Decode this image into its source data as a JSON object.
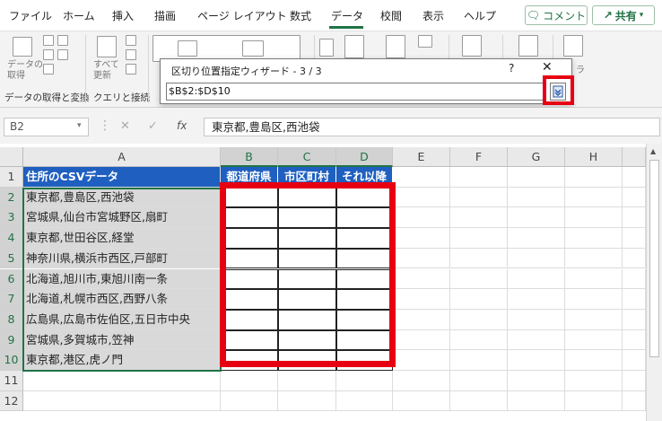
{
  "ribbon_tabs": [
    "ファイル",
    "ホーム",
    "挿入",
    "描画",
    "ページ レイアウト",
    "数式",
    "データ",
    "校閲",
    "表示",
    "ヘルプ"
  ],
  "active_tab": "データ",
  "comment_label": "コメント",
  "share_label": "共有",
  "ribbon": {
    "get_data_label": "データの\n取得",
    "refresh_all_label": "すべて\n更新",
    "group_get_transform": "データの取得と変換",
    "group_queries": "クエリと接続",
    "partial_sort_text": "ラ"
  },
  "dialog": {
    "title": "区切り位置指定ウィザード - 3 / 3",
    "help": "?",
    "close": "✕",
    "input_value": "$B$2:$D$10"
  },
  "formula_bar": {
    "name_box": "B2",
    "cancel": "✕",
    "confirm": "✓",
    "fx": "fx",
    "formula": "東京都,豊島区,西池袋"
  },
  "columns": [
    "A",
    "B",
    "C",
    "D",
    "E",
    "F",
    "G",
    "H"
  ],
  "rows": [
    "1",
    "2",
    "3",
    "4",
    "5",
    "6",
    "7",
    "8",
    "9",
    "10",
    "11",
    "12"
  ],
  "sheet": {
    "A1": "住所のCSVデータ",
    "B1": "都道府県",
    "C1": "市区町村",
    "D1": "それ以降",
    "A": [
      "東京都,豊島区,西池袋",
      "宮城県,仙台市宮城野区,扇町",
      "東京都,世田谷区,経堂",
      "神奈川県,横浜市西区,戸部町",
      "北海道,旭川市,東旭川南一条",
      "北海道,札幌市西区,西野八条",
      "広島県,広島市佐伯区,五日市中央",
      "宮城県,多賀城市,笠神",
      "東京都,港区,虎ノ門"
    ]
  },
  "colors": {
    "accent": "#217346",
    "header_fill": "#1f5fbf",
    "highlight": "#e60012"
  }
}
